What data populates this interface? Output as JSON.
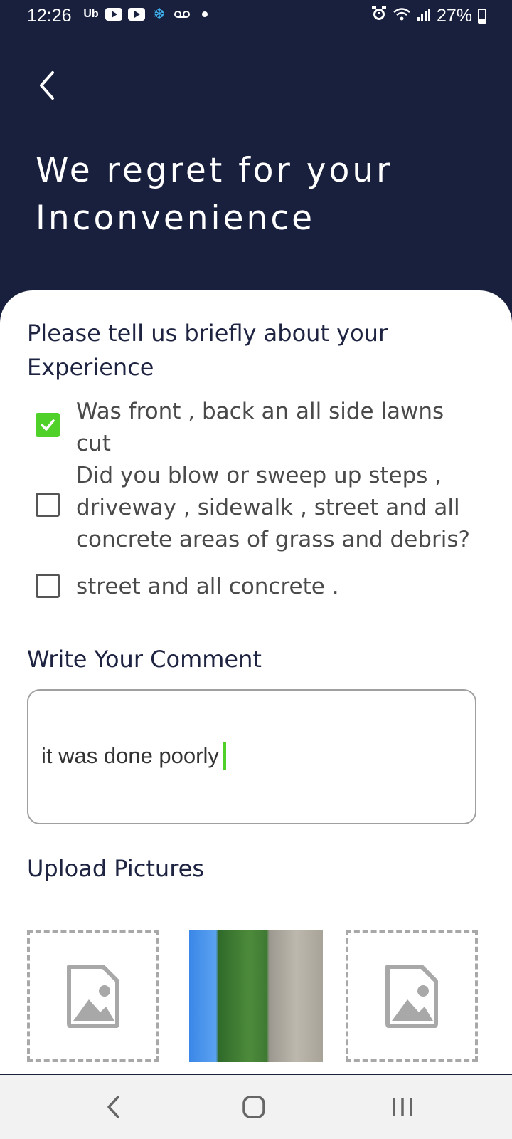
{
  "status_bar": {
    "time": "12:26",
    "battery": "27%",
    "icons_left": [
      "uber-icon",
      "youtube-icon",
      "youtube-icon",
      "snowflake-icon",
      "voicemail-icon",
      "dot-icon"
    ],
    "icons_right": [
      "alarm-icon",
      "wifi-icon",
      "signal-icon",
      "battery-icon"
    ]
  },
  "header": {
    "title": "We regret for your Inconvenience"
  },
  "experience": {
    "heading": "Please tell us briefly about your Experience",
    "options": [
      {
        "label": "Was front , back an all side lawns cut",
        "checked": true
      },
      {
        "label": "Did you blow or sweep up steps , driveway , sidewalk , street and all concrete areas of grass and debris?",
        "checked": false
      },
      {
        "label": "street and all concrete .",
        "checked": false
      }
    ]
  },
  "comment": {
    "heading": "Write Your Comment",
    "value": "it was done poorly"
  },
  "upload": {
    "heading": "Upload Pictures"
  },
  "colors": {
    "header_bg": "#18203d",
    "accent_green": "#4fd12a"
  }
}
